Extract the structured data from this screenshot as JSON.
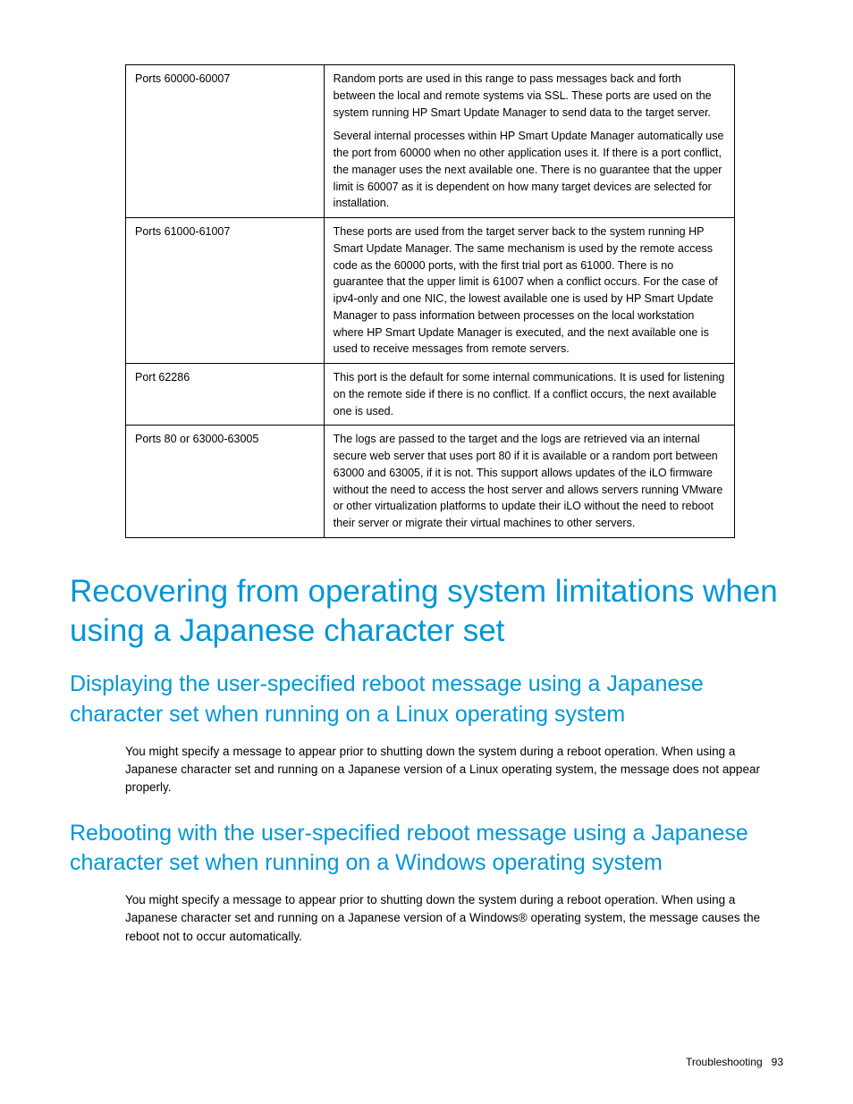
{
  "table": {
    "rows": [
      {
        "port": "Ports 60000-60007",
        "desc_p1": "Random ports are used in this range to pass messages back and forth between the local and remote systems via SSL. These ports are used on the system running HP Smart Update Manager to send data to the target server.",
        "desc_p2": "Several internal processes within HP Smart Update Manager automatically use the port from 60000 when no other application uses it. If there is a port conflict, the manager uses the next available one. There is no guarantee that the upper limit is 60007 as it is dependent on how many target devices are selected for installation."
      },
      {
        "port": "Ports 61000-61007",
        "desc_p1": "These ports are used from the target server back to the system running HP Smart Update Manager. The same mechanism is used by the remote access code as the 60000 ports, with the first trial port as 61000. There is no guarantee that the upper limit is 61007 when a conflict occurs. For the case of ipv4-only and one NIC, the lowest available one is used by HP Smart Update Manager to pass information between processes on the local workstation where HP Smart Update Manager is executed, and the next available one is used to receive messages from remote servers."
      },
      {
        "port": "Port 62286",
        "desc_p1": "This port is the default for some internal communications. It is used for listening on the remote side if there is no conflict. If a conflict occurs, the next available one is used."
      },
      {
        "port": "Ports 80 or 63000-63005",
        "desc_p1": "The logs are passed to the target and the logs are retrieved via an internal secure web server that uses port 80 if it is available or a random port between 63000 and 63005, if it is not. This support allows updates of the iLO firmware without the need to access the host server and allows servers running VMware or other virtualization platforms to update their iLO without the need to reboot their server or migrate their virtual machines to other servers."
      }
    ]
  },
  "heading1": "Recovering from operating system limitations when using a Japanese character set",
  "section1": {
    "heading": "Displaying the user-specified reboot message using a Japanese character set when running on a Linux operating system",
    "body": "You might specify a message to appear prior to shutting down the system during a reboot operation. When using a Japanese character set and running on a Japanese version of a Linux operating system, the message does not appear properly."
  },
  "section2": {
    "heading": "Rebooting with the user-specified reboot message using a Japanese character set when running on a Windows operating system",
    "body": "You might specify a message to appear prior to shutting down the system during a reboot operation. When using a Japanese character set and running on a Japanese version of a Windows® operating system, the message causes the reboot not to occur automatically."
  },
  "footer": {
    "section": "Troubleshooting",
    "page": "93"
  }
}
